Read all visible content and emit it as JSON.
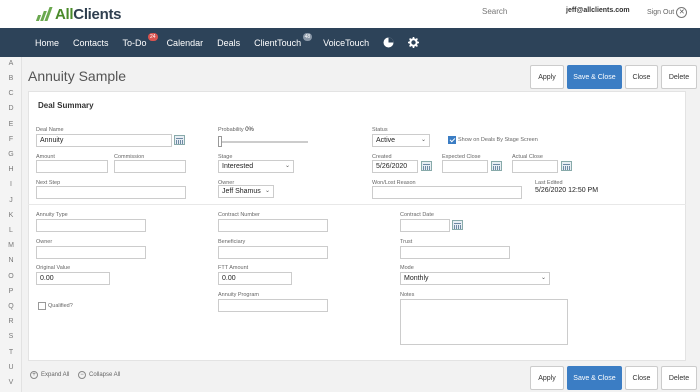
{
  "brand": {
    "name_a": "All",
    "name_b": "Clients"
  },
  "header": {
    "search": "Search",
    "email": "jeff@allclients.com",
    "signout": "Sign Out"
  },
  "nav": {
    "items": [
      "Home",
      "Contacts",
      "To-Do",
      "Calendar",
      "Deals",
      "ClientTouch",
      "VoiceTouch"
    ],
    "todo_badge": "24",
    "clienttouch_badge": "48"
  },
  "alphabet": [
    "A",
    "B",
    "C",
    "D",
    "E",
    "F",
    "G",
    "H",
    "I",
    "J",
    "K",
    "L",
    "M",
    "N",
    "O",
    "P",
    "Q",
    "R",
    "S",
    "T",
    "U",
    "V"
  ],
  "page": {
    "title": "Annuity Sample"
  },
  "buttons": {
    "apply": "Apply",
    "save_close": "Save & Close",
    "close": "Close",
    "delete": "Delete"
  },
  "section": {
    "title": "Deal Summary"
  },
  "fields": {
    "deal_name": {
      "label": "Deal Name",
      "value": "Annuity"
    },
    "probability": {
      "label": "Probability",
      "value": "0%"
    },
    "status": {
      "label": "Status",
      "value": "Active"
    },
    "show_on_deals": {
      "label": "Show on Deals By Stage Screen",
      "checked": true
    },
    "amount": {
      "label": "Amount",
      "value": ""
    },
    "commission": {
      "label": "Commission",
      "value": ""
    },
    "stage": {
      "label": "Stage",
      "value": "Interested"
    },
    "created": {
      "label": "Created",
      "value": "5/26/2020"
    },
    "expected_close": {
      "label": "Expected Close",
      "value": ""
    },
    "actual_close": {
      "label": "Actual Close",
      "value": ""
    },
    "next_step": {
      "label": "Next Step",
      "value": ""
    },
    "owner": {
      "label": "Owner",
      "value": "Jeff Shamus"
    },
    "won_lost_reason": {
      "label": "Won/Lost Reason",
      "value": ""
    },
    "last_edited": {
      "label": "Last Edited",
      "value": "5/26/2020 12:50 PM"
    },
    "annuity_type": {
      "label": "Annuity Type",
      "value": ""
    },
    "contract_number": {
      "label": "Contract Number",
      "value": ""
    },
    "contract_date": {
      "label": "Contract Date",
      "value": ""
    },
    "owner2": {
      "label": "Owner",
      "value": ""
    },
    "beneficiary": {
      "label": "Beneficiary",
      "value": ""
    },
    "trust": {
      "label": "Trust",
      "value": ""
    },
    "original_value": {
      "label": "Original Value",
      "value": "0.00"
    },
    "ftt_amount": {
      "label": "FTT Amount",
      "value": "0.00"
    },
    "mode": {
      "label": "Mode",
      "value": "Monthly"
    },
    "qualified": {
      "label": "Qualified?",
      "checked": false
    },
    "annuity_program": {
      "label": "Annuity Program",
      "value": ""
    },
    "notes": {
      "label": "Notes",
      "value": ""
    }
  },
  "footer": {
    "expand_all": "Expand All",
    "collapse_all": "Collapse All"
  }
}
